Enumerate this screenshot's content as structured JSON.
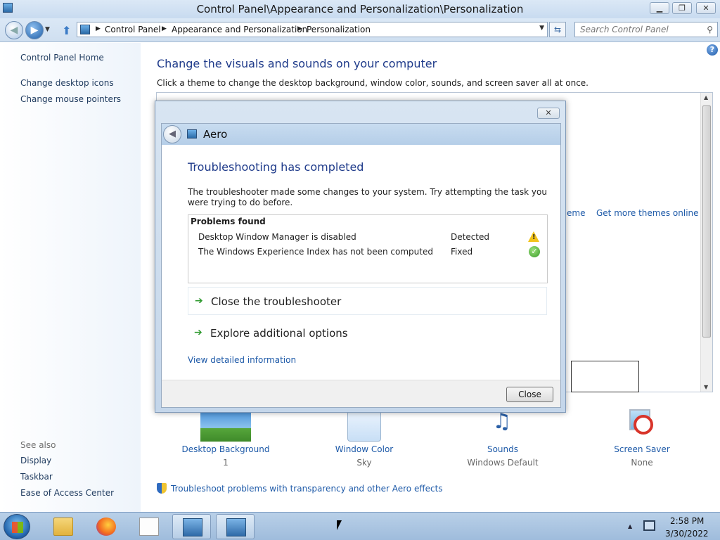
{
  "window": {
    "title": "Control Panel\\Appearance and Personalization\\Personalization",
    "min_label": "▁",
    "max_label": "❐",
    "close_label": "✕"
  },
  "address": {
    "crumbs": [
      "Control Panel",
      "Appearance and Personalization",
      "Personalization"
    ],
    "search_placeholder": "Search Control Panel"
  },
  "sidebar": {
    "home": "Control Panel Home",
    "links": [
      "Change desktop icons",
      "Change mouse pointers"
    ],
    "see_also": "See also",
    "see_also_links": [
      "Display",
      "Taskbar",
      "Ease of Access Center"
    ]
  },
  "main": {
    "heading": "Change the visuals and sounds on your computer",
    "subtitle": "Click a theme to change the desktop background, window color, sounds, and screen saver all at once.",
    "partial_link": "eme",
    "get_more": "Get more themes online",
    "help_label": "?",
    "tiles": [
      {
        "label": "Desktop Background",
        "value": "1"
      },
      {
        "label": "Window Color",
        "value": "Sky"
      },
      {
        "label": "Sounds",
        "value": "Windows Default"
      },
      {
        "label": "Screen Saver",
        "value": "None"
      }
    ],
    "troubleshoot_link": "Troubleshoot problems with transparency and other Aero effects"
  },
  "dialog": {
    "nav_title": "Aero",
    "heading": "Troubleshooting has completed",
    "description": "The troubleshooter made some changes to your system. Try attempting the task you were trying to do before.",
    "problems_header": "Problems found",
    "problems": [
      {
        "name": "Desktop Window Manager is disabled",
        "status": "Detected",
        "icon": "warning-icon"
      },
      {
        "name": "The Windows Experience Index has not been computed",
        "status": "Fixed",
        "icon": "check-icon"
      }
    ],
    "options": [
      "Close the troubleshooter",
      "Explore additional options"
    ],
    "detail_link": "View detailed information",
    "close_button": "Close",
    "close_x": "✕"
  },
  "taskbar": {
    "time": "2:58 PM",
    "date": "3/30/2022"
  },
  "colors": {
    "link": "#1e5aa8",
    "heading": "#1e3a8a",
    "warning": "#f2c31a",
    "ok": "#3a9a2a"
  }
}
